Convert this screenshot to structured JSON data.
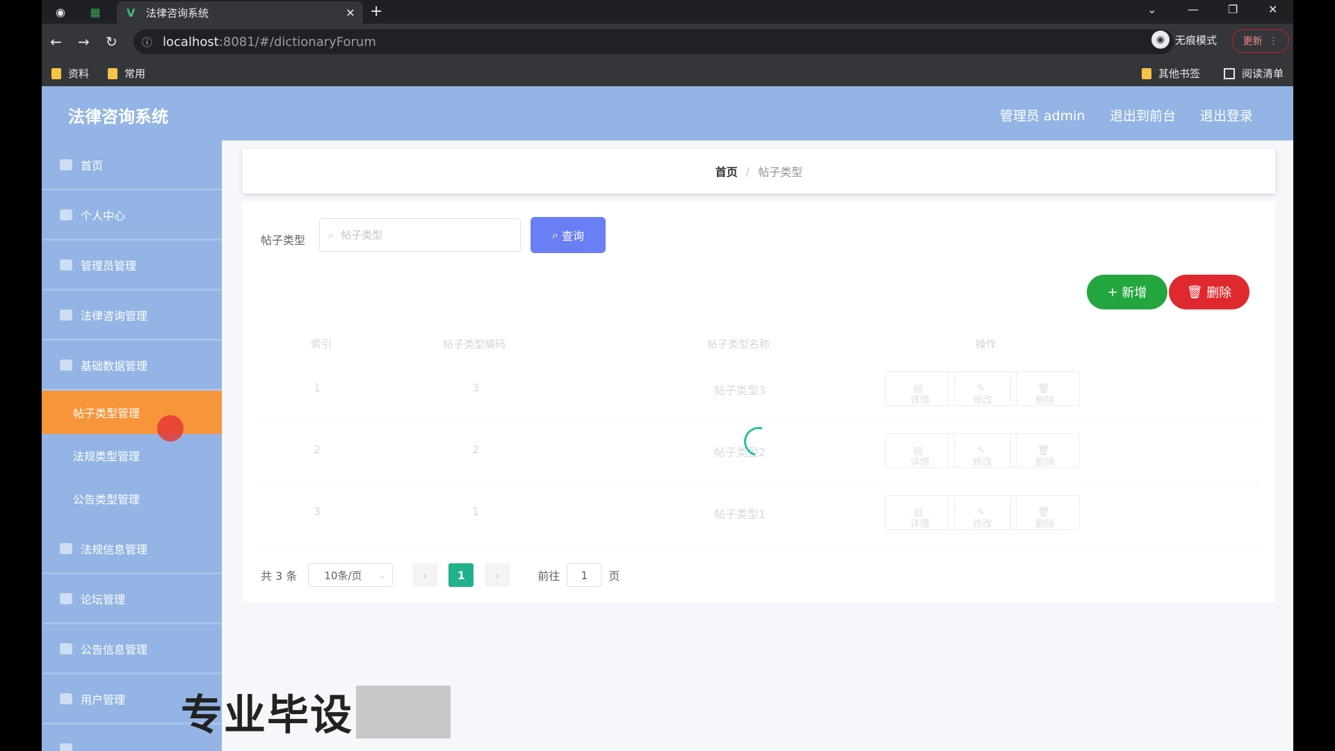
{
  "browser": {
    "tab_title": "法律咨询系统",
    "url_host": "localhost",
    "url_rest": ":8081/#/dictionaryForum",
    "incognito_label": "无痕模式",
    "update_label": "更新",
    "bookmarks": [
      "资料",
      "常用"
    ],
    "other_bookmarks": "其他书签",
    "reading_list": "阅读清单"
  },
  "header": {
    "title": "法律咨询系统",
    "user": "管理员 admin",
    "back_front": "退出到前台",
    "logout": "退出登录"
  },
  "sidebar": {
    "items": [
      {
        "label": "首页"
      },
      {
        "label": "个人中心"
      },
      {
        "label": "管理员管理"
      },
      {
        "label": "法律咨询管理"
      },
      {
        "label": "基础数据管理"
      }
    ],
    "subitems": [
      {
        "label": "帖子类型管理"
      },
      {
        "label": "法规类型管理"
      },
      {
        "label": "公告类型管理"
      }
    ],
    "items_after": [
      {
        "label": "法规信息管理"
      },
      {
        "label": "论坛管理"
      },
      {
        "label": "公告信息管理"
      },
      {
        "label": "用户管理"
      }
    ]
  },
  "breadcrumb": {
    "home": "首页",
    "separator": "/",
    "current": "帖子类型"
  },
  "search": {
    "label": "帖子类型",
    "placeholder": "帖子类型",
    "button": "查询"
  },
  "actions": {
    "add": "新增",
    "delete": "删除"
  },
  "table": {
    "headers": [
      "索引",
      "帖子类型编码",
      "帖子类型名称",
      "操作"
    ],
    "rows": [
      {
        "index": "1",
        "code": "3",
        "name": "帖子类型3"
      },
      {
        "index": "2",
        "code": "2",
        "name": "帖子类型2"
      },
      {
        "index": "3",
        "code": "1",
        "name": "帖子类型1"
      }
    ],
    "row_actions": {
      "detail": "详情",
      "edit": "修改",
      "delete": "删除"
    }
  },
  "pagination": {
    "total": "共 3 条",
    "page_size": "10条/页",
    "current_page": "1",
    "goto_label": "前往",
    "goto_value": "1",
    "page_suffix": "页"
  },
  "overlay": {
    "watermark": "专业毕设"
  }
}
